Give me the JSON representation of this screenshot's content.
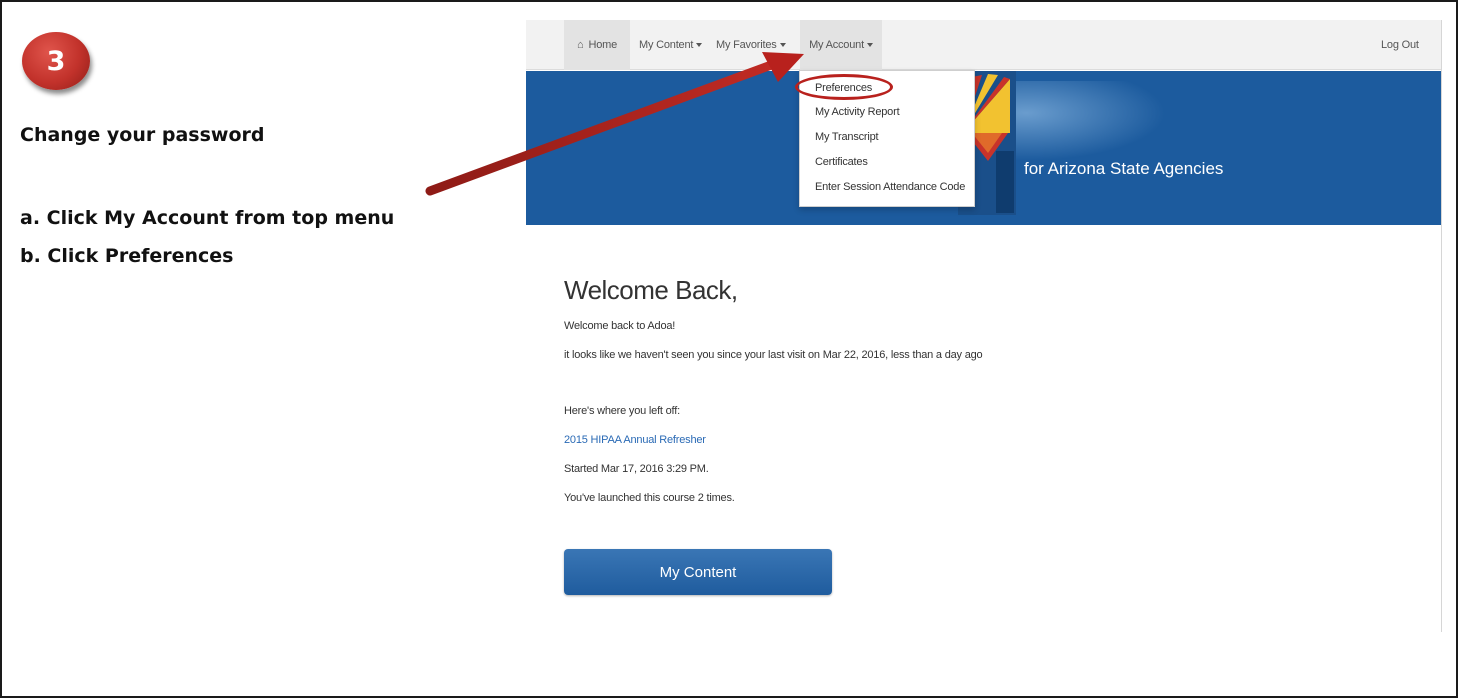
{
  "step": {
    "number": "3"
  },
  "instructions": {
    "heading": "Change your password",
    "step_a": "a. Click My Account from top menu",
    "step_b": "b. Click Preferences"
  },
  "navbar": {
    "home": "Home",
    "my_content": "My Content",
    "my_favorites": "My Favorites",
    "my_account": "My Account",
    "log_out": "Log Out",
    "home_icon": "home-icon"
  },
  "account_menu": {
    "items": [
      "Preferences",
      "My Activity Report",
      "My Transcript",
      "Certificates",
      "Enter Session Attendance Code"
    ]
  },
  "banner": {
    "title": "for Arizona State Agencies"
  },
  "welcome": {
    "title": "Welcome Back,",
    "line1": "Welcome back to Adoa!",
    "line2": "it looks like we haven't seen you since your last visit on Mar 22, 2016, less than a day ago",
    "left_off": "Here's where you left off:",
    "course": "2015 HIPAA Annual Refresher",
    "started": "Started Mar 17, 2016 3:29 PM.",
    "launched": "You've launched this course 2 times."
  },
  "buttons": {
    "my_content": "My Content"
  },
  "colors": {
    "banner": "#1c5b9e",
    "badge": "#c2322b",
    "link": "#2a6ab5",
    "highlight": "#b8211d"
  }
}
